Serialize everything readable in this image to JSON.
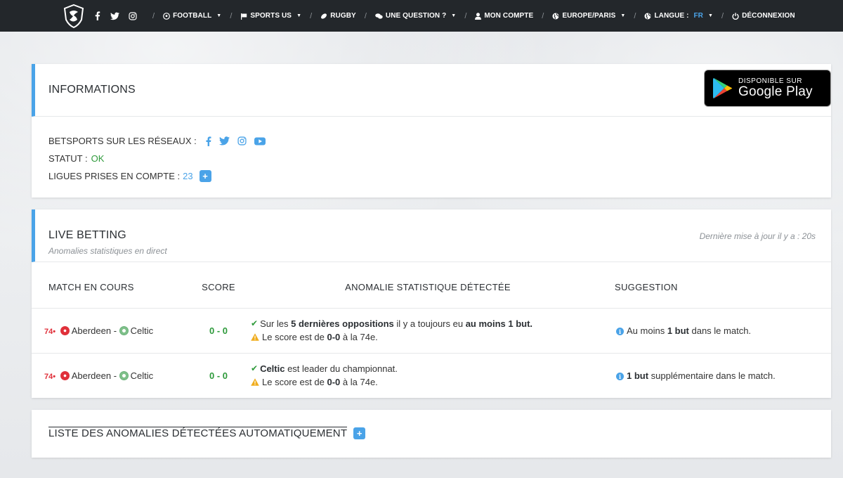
{
  "nav": {
    "items": [
      {
        "id": "football",
        "label": "Football",
        "icon": "soccer-ball-icon",
        "caret": true
      },
      {
        "id": "sports-us",
        "label": "Sports US",
        "icon": "flag-icon",
        "caret": true
      },
      {
        "id": "rugby",
        "label": "Rugby",
        "icon": "rugby-ball-icon",
        "caret": false
      },
      {
        "id": "question",
        "label": "Une question ?",
        "icon": "chat-icon",
        "caret": true
      },
      {
        "id": "compte",
        "label": "Mon compte",
        "icon": "user-icon",
        "caret": false
      },
      {
        "id": "timezone",
        "label": "Europe/Paris",
        "icon": "globe-icon",
        "caret": true
      },
      {
        "id": "langue",
        "label": "Langue : ",
        "lang": "FR",
        "icon": "globe-icon",
        "caret": true
      },
      {
        "id": "logout",
        "label": "Déconnexion",
        "icon": "power-icon",
        "caret": false
      }
    ],
    "separator": "/"
  },
  "info": {
    "title": "Informations",
    "google_play": {
      "small": "DISPONIBLE SUR",
      "big": "Google Play"
    },
    "networks_label": "Betsports sur les réseaux :",
    "status_label": "Statut :",
    "status_value": "OK",
    "leagues_label": "Ligues prises en compte :",
    "leagues_count": "23",
    "plus": "+"
  },
  "live": {
    "title": "Live Betting",
    "subtitle": "Anomalies statistiques en direct",
    "updated": "Dernière mise à jour il y a : 20s",
    "headers": {
      "match": "Match en cours",
      "score": "Score",
      "anomaly": "Anomalie statistique détectée",
      "suggestion": "Suggestion"
    },
    "rows": [
      {
        "minute": "74•",
        "home": "Aberdeen",
        "sep": " - ",
        "away": "Celtic",
        "score": "0 - 0",
        "anom1": {
          "a": "Sur les ",
          "b": "5 dernières oppositions",
          "c": " il y a toujours eu ",
          "d": "au moins 1 but",
          "e": "."
        },
        "anom2": {
          "a": "Le score est de ",
          "b": "0-0",
          "c": " à la 74e."
        },
        "sugg": {
          "a": "Au moins ",
          "b": "1 but",
          "c": " dans le match."
        }
      },
      {
        "minute": "74•",
        "home": "Aberdeen",
        "sep": " - ",
        "away": "Celtic",
        "score": "0 - 0",
        "anom1": {
          "a": "",
          "b": "Celtic",
          "c": " est leader du championnat.",
          "d": "",
          "e": ""
        },
        "anom2": {
          "a": "Le score est de ",
          "b": "0-0",
          "c": " à la 74e."
        },
        "sugg": {
          "a": "",
          "b": "1 but",
          "c": " supplémentaire dans le match."
        }
      }
    ]
  },
  "liste": {
    "title": "Liste des anomalies détectées automatiquement",
    "plus": "+"
  },
  "colors": {
    "navbar": "#23272b",
    "accent": "#4aa3e8",
    "ok": "#2e9a3b",
    "live_minute": "#e0303a",
    "warning": "#f0ad1e"
  }
}
